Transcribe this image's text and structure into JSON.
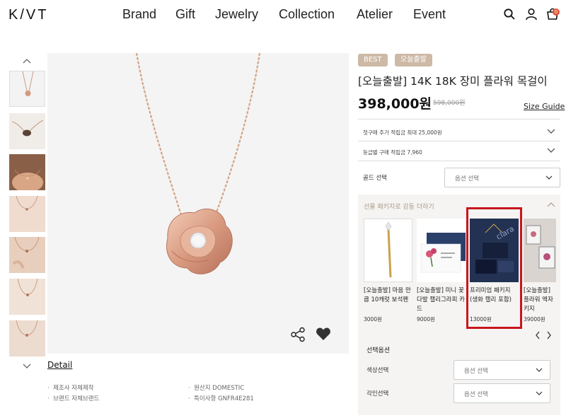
{
  "header": {
    "logo": "K/VT",
    "nav": [
      "Brand",
      "Gift",
      "Jewelry",
      "Collection",
      "Atelier",
      "Event"
    ],
    "icons": [
      "search-icon",
      "user-icon",
      "cart-icon"
    ],
    "cart_count": "0"
  },
  "product": {
    "badges": [
      "BEST",
      "오늘출발"
    ],
    "title": "[오늘출발] 14K 18K 장미 플라워 목걸이",
    "price": "398,000원",
    "original_price": "598,000원",
    "size_guide": "Size Guide",
    "benefits": [
      "첫구매 추가 적립금 최대 25,000원",
      "등급별 구매 적립금 7,960"
    ],
    "gold_label": "골드 선택",
    "select_placeholder": "옵션 선택"
  },
  "package": {
    "title": "선물 패키지로 감동 더하기",
    "items": [
      {
        "name": "[오늘출발] 마음 만큼 10캐럿 보석펜",
        "price": "3000원"
      },
      {
        "name": "[오늘출발] 미니 꽃다발 캘리그라피 카드",
        "price": "9000원"
      },
      {
        "name": "프리미엄 패키지 (생화 캘리 포함)",
        "price": "13000원"
      },
      {
        "name": "[오늘출발] 플라워 액자 키지",
        "price": "39000원"
      }
    ],
    "watermark": "clara"
  },
  "options": {
    "title": "선택옵션",
    "rows": [
      {
        "label": "색상선택",
        "placeholder": "옵션 선택"
      },
      {
        "label": "각인선택",
        "placeholder": "옵션 선택"
      }
    ]
  },
  "detail": {
    "tab": "Detail",
    "info": [
      "제조사 자체제작",
      "브랜드 자체브랜드",
      "원산지 DOMESTIC",
      "특이사항 GNFR4E281"
    ]
  },
  "colors": {
    "badge": "#cdb9a6",
    "highlight": "#c8161d",
    "cart_badge": "#e0553a",
    "package_bg": "#f5f4f2"
  }
}
